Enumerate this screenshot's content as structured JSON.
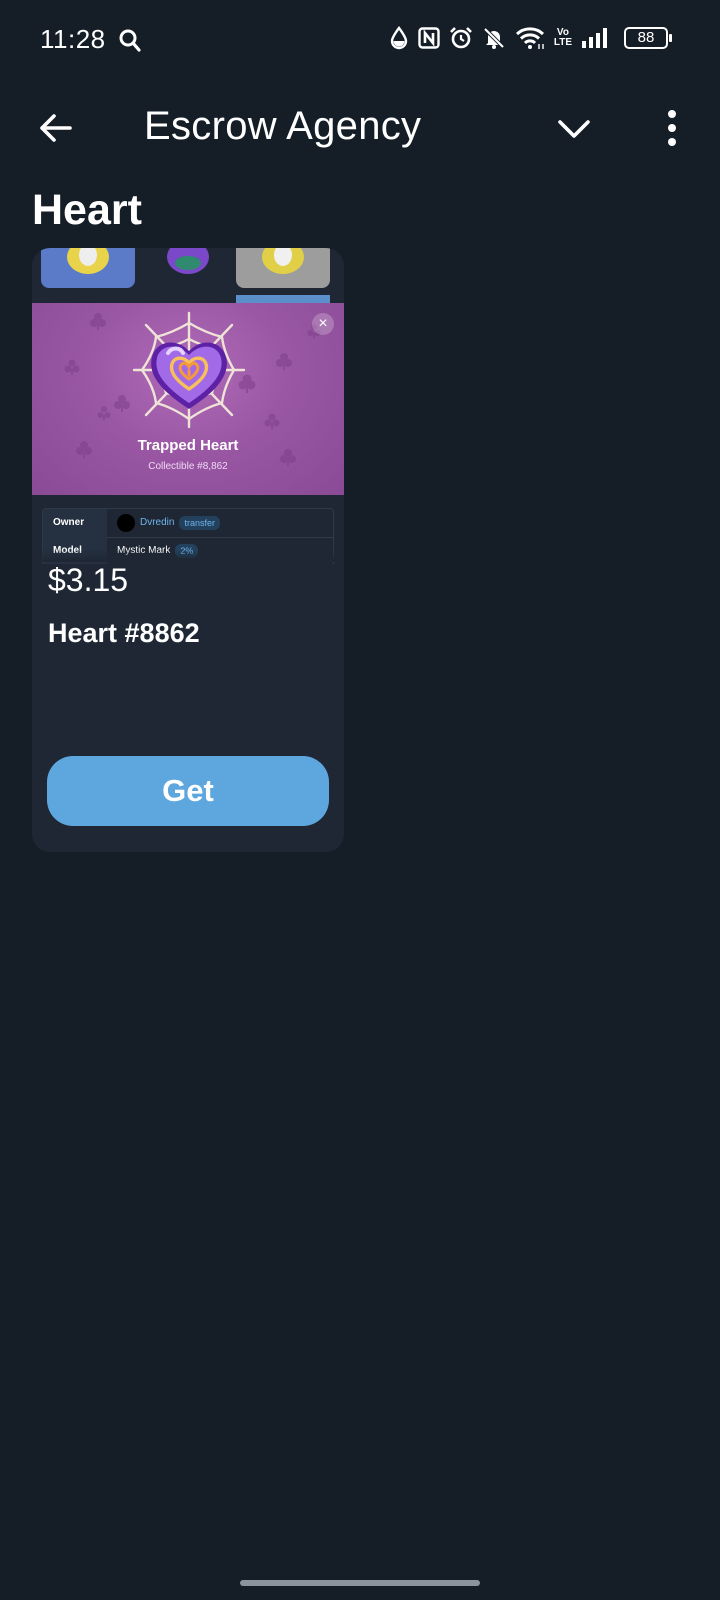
{
  "status_bar": {
    "time": "11:28",
    "icons": [
      "search-icon",
      "data-saver-icon",
      "nfc-icon",
      "alarm-icon",
      "bell-off-icon",
      "wifi-icon",
      "volte-icon",
      "signal-icon",
      "battery-icon"
    ],
    "volte_top": "Vo",
    "volte_bottom": "LTE",
    "battery": "88"
  },
  "app_bar": {
    "title": "Escrow Agency"
  },
  "section_title": "Heart",
  "card": {
    "preview": {
      "title": "Trapped Heart",
      "subtitle": "Collectible #8,862",
      "close_icon": "×",
      "background_color": "#9a58a4"
    },
    "table": {
      "owner_label": "Owner",
      "owner_name": "Dvredin",
      "owner_badge": "transfer",
      "model_label": "Model",
      "model_value": "Mystic Mark",
      "model_badge": "2%"
    },
    "price": "$3.15",
    "gift_name": "Heart #8862",
    "get_button": "Get"
  },
  "colors": {
    "background": "#151e27",
    "card": "#1e2733",
    "accent": "#5ea7de",
    "link": "#70b4ee"
  }
}
